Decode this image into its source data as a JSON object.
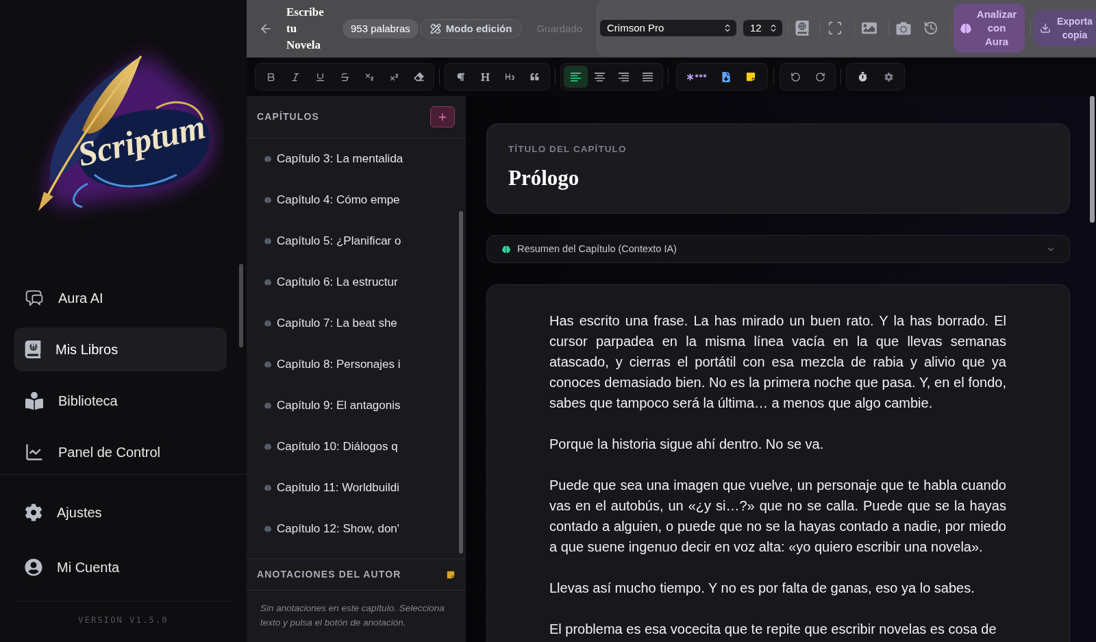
{
  "sidebar": {
    "logo": {
      "text": "Scriptum"
    },
    "nav_items": [
      {
        "label": "Aura AI",
        "selected": false
      },
      {
        "label": "Mis Libros",
        "selected": true
      },
      {
        "label": "Biblioteca",
        "selected": false
      },
      {
        "label": "Panel de Control",
        "selected": false
      }
    ],
    "bottom_items": [
      {
        "label": "Ajustes",
        "selected": false
      },
      {
        "label": "Mi Cuenta",
        "selected": false
      }
    ],
    "version": "VERSION V1.5.0"
  },
  "header": {
    "title": "Escribe tu Novela",
    "word_count": "953 palabras",
    "mode_button": "Modo edición",
    "save_status": "Guardado",
    "font_select": "Crimson Pro",
    "size_select": "12",
    "analyze_button": "Analizar con Aura",
    "export_button": "Exporta copia"
  },
  "toolbar": {
    "alignment": [
      {
        "selected": true
      },
      {
        "selected": false
      },
      {
        "selected": false
      },
      {
        "selected": false
      }
    ]
  },
  "chapters_panel": {
    "title": "CAPÍTULOS",
    "chapters": [
      {
        "label": "Capítulo 3: La mentalida",
        "selected": false
      },
      {
        "label": "Capítulo 4: Cómo empe",
        "selected": false
      },
      {
        "label": "Capítulo 5: ¿Planificar o",
        "selected": false
      },
      {
        "label": "Capítulo 6: La estructur",
        "selected": false
      },
      {
        "label": "Capítulo 7: La beat she",
        "selected": false
      },
      {
        "label": "Capítulo 8: Personajes i",
        "selected": false
      },
      {
        "label": "Capítulo 9: El antagonis",
        "selected": false
      },
      {
        "label": "Capítulo 10: Diálogos q",
        "selected": false
      },
      {
        "label": "Capítulo 11: Worldbuildi",
        "selected": false
      },
      {
        "label": "Capítulo 12: Show, don'",
        "selected": false
      }
    ],
    "annotations": {
      "title": "ANOTACIONES DEL AUTOR",
      "empty_text": "Sin anotaciones en este capítulo. Selecciona texto y pulsa el botón de anotación."
    }
  },
  "editor": {
    "title_label": "TÍTULO DEL CAPÍTULO",
    "title": "Prólogo",
    "summary": {
      "label": "Resumen del Capítulo (Contexto IA)",
      "expanded": false
    },
    "paragraphs": [
      "Has escrito una frase. La has mirado un buen rato. Y la has borrado. El cursor parpadea en la misma línea vacía en la que llevas semanas atascado, y cierras el portátil con esa mezcla de rabia y alivio que ya conoces demasiado bien. No es la primera noche que pasa. Y, en el fondo, sabes que tampoco será la última… a menos que algo cambie.",
      "Porque la historia sigue ahí dentro. No se va.",
      "Puede que sea una imagen que vuelve, un personaje que te habla cuando vas en el autobús, un «¿y si…?» que no se calla. Puede que se la hayas contado a alguien, o puede que no se la hayas contado a nadie, por miedo a que suene ingenuo decir en voz alta: «yo quiero escribir una novela».",
      "Llevas así mucho tiempo. Y no es por falta de ganas, eso ya lo sabes.",
      "El problema es esa vocecita que te repite que escribir novelas es cosa de"
    ]
  }
}
